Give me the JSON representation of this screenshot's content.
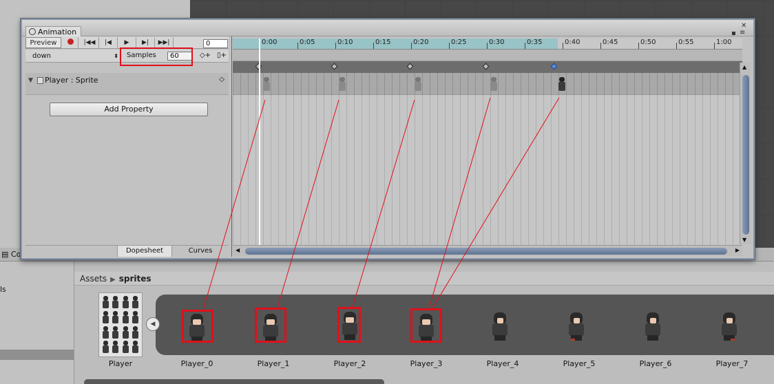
{
  "background": {
    "console_tab": "Co",
    "left_label": "ls"
  },
  "project": {
    "breadcrumb": [
      "Assets",
      "sprites"
    ],
    "sheet_label": "Player",
    "sprites": [
      "Player_0",
      "Player_1",
      "Player_2",
      "Player_3",
      "Player_4",
      "Player_5",
      "Player_6",
      "Player_7"
    ]
  },
  "animation": {
    "tab_title": "Animation",
    "preview_label": "Preview",
    "frame_value": "0",
    "clip": "down",
    "samples_label": "Samples",
    "samples_value": "60",
    "property": "Player : Sprite",
    "add_property_label": "Add Property",
    "footer_tabs": [
      "Dopesheet",
      "Curves"
    ],
    "ruler_ticks": [
      "0:00",
      "0:05",
      "0:10",
      "0:15",
      "0:20",
      "0:25",
      "0:30",
      "0:35",
      "0:40",
      "0:45",
      "0:50",
      "0:55",
      "1:00"
    ],
    "keyframes_frames": [
      0,
      10,
      20,
      30,
      39
    ]
  },
  "colors": {
    "highlight": "#e0101a",
    "playhead": "#ffffff",
    "selected_key": "#5a8fe0"
  },
  "icons": [
    "clock-icon",
    "record-icon",
    "first-frame-icon",
    "prev-frame-icon",
    "play-icon",
    "next-frame-icon",
    "last-frame-icon",
    "add-keyframe-icon",
    "add-event-icon",
    "lock-icon",
    "menu-icon",
    "close-icon"
  ]
}
